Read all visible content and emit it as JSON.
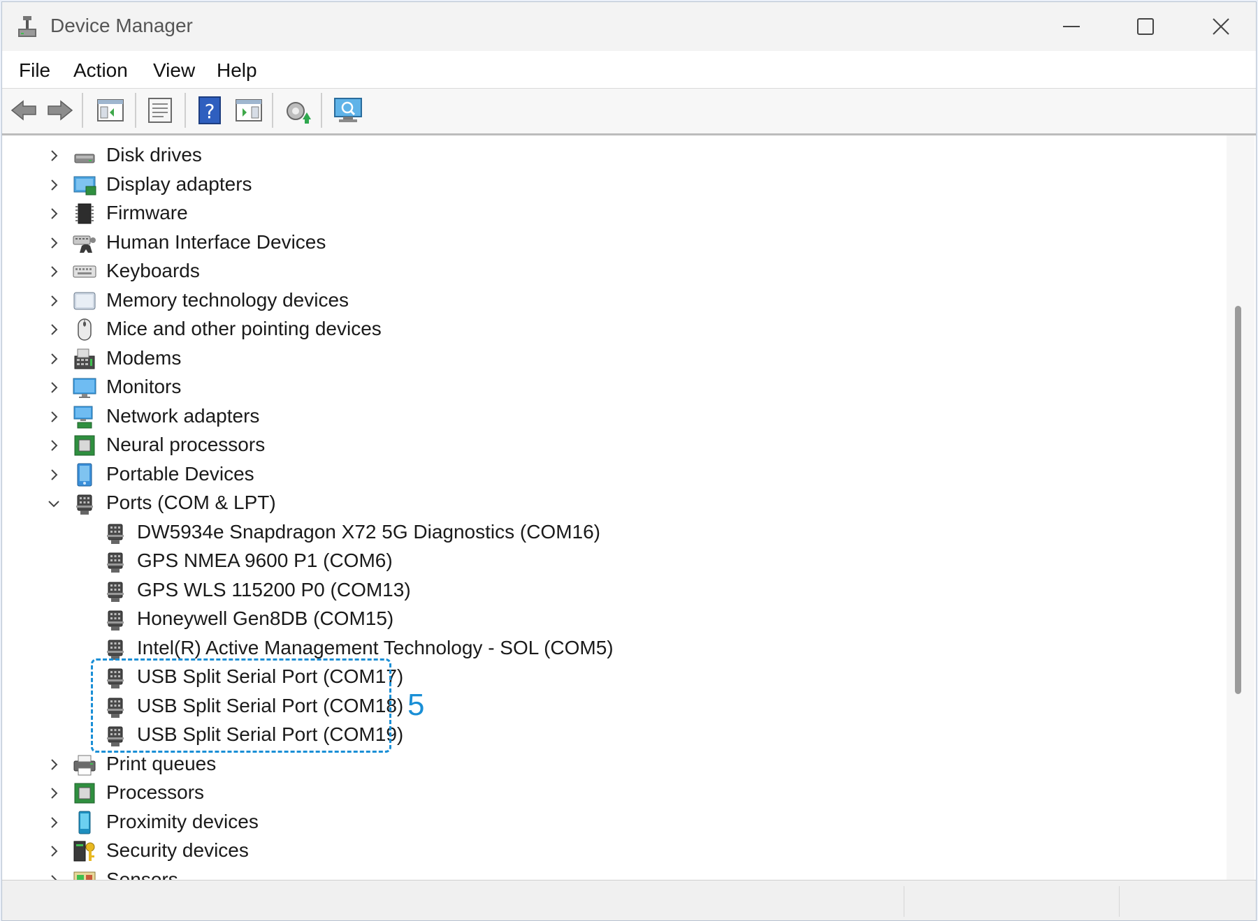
{
  "window": {
    "title": "Device Manager"
  },
  "menu": [
    {
      "label": "File"
    },
    {
      "label": "Action"
    },
    {
      "label": "View"
    },
    {
      "label": "Help"
    }
  ],
  "toolbar": [
    {
      "icon": "back-arrow-icon"
    },
    {
      "icon": "forward-arrow-icon"
    },
    {
      "icon": "show-hide-console-tree-icon"
    },
    {
      "icon": "properties-icon"
    },
    {
      "icon": "help-icon"
    },
    {
      "icon": "action-pane-icon"
    },
    {
      "icon": "update-driver-icon"
    },
    {
      "icon": "scan-hardware-changes-icon"
    }
  ],
  "tree": {
    "categories_before": [
      {
        "label": "Disk drives",
        "icon": "disk-drive-icon"
      },
      {
        "label": "Display adapters",
        "icon": "display-adapter-icon"
      },
      {
        "label": "Firmware",
        "icon": "firmware-icon"
      },
      {
        "label": "Human Interface Devices",
        "icon": "hid-icon"
      },
      {
        "label": "Keyboards",
        "icon": "keyboard-icon"
      },
      {
        "label": "Memory technology devices",
        "icon": "memory-device-icon"
      },
      {
        "label": "Mice and other pointing devices",
        "icon": "mouse-icon"
      },
      {
        "label": "Modems",
        "icon": "modem-icon"
      },
      {
        "label": "Monitors",
        "icon": "monitor-icon"
      },
      {
        "label": "Network adapters",
        "icon": "network-adapter-icon"
      },
      {
        "label": "Neural processors",
        "icon": "neural-processor-icon"
      },
      {
        "label": "Portable Devices",
        "icon": "portable-device-icon"
      }
    ],
    "expanded": {
      "label": "Ports (COM & LPT)",
      "icon": "port-icon",
      "children": [
        {
          "label": "DW5934e Snapdragon X72 5G Diagnostics (COM16)"
        },
        {
          "label": "GPS NMEA 9600 P1 (COM6)"
        },
        {
          "label": "GPS WLS 115200 P0 (COM13)"
        },
        {
          "label": "Honeywell Gen8DB (COM15)"
        },
        {
          "label": "Intel(R) Active Management Technology - SOL (COM5)"
        },
        {
          "label": "USB Split Serial Port (COM17)"
        },
        {
          "label": "USB Split Serial Port (COM18)"
        },
        {
          "label": "USB Split Serial Port (COM19)"
        }
      ]
    },
    "categories_after": [
      {
        "label": "Print queues",
        "icon": "printer-icon"
      },
      {
        "label": "Processors",
        "icon": "processor-icon"
      },
      {
        "label": "Proximity devices",
        "icon": "proximity-device-icon"
      },
      {
        "label": "Security devices",
        "icon": "security-device-icon"
      },
      {
        "label": "Sensors",
        "icon": "sensor-icon"
      }
    ]
  },
  "annotation": {
    "callout": "5"
  },
  "colors": {
    "highlight": "#1a8fd6",
    "accent": "#2b7fd4"
  }
}
